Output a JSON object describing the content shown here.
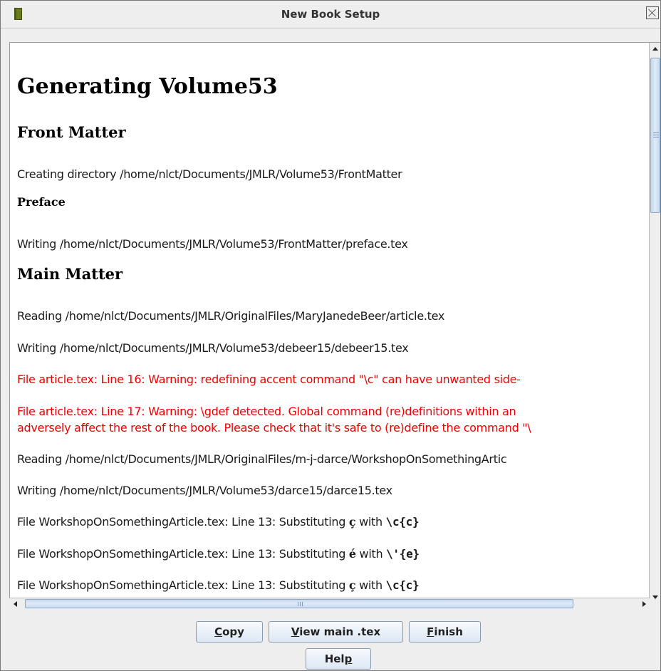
{
  "window": {
    "title": "New Book Setup"
  },
  "doc": {
    "heading": "Generating Volume53",
    "front_matter": {
      "heading": "Front Matter",
      "creating": "Creating directory /home/nlct/Documents/JMLR/Volume53/FrontMatter",
      "preface_heading": "Preface",
      "preface_writing": "Writing /home/nlct/Documents/JMLR/Volume53/FrontMatter/preface.tex"
    },
    "main_matter": {
      "heading": "Main Matter",
      "reading1": "Reading /home/nlct/Documents/JMLR/OriginalFiles/MaryJanedeBeer/article.tex",
      "writing1": "Writing /home/nlct/Documents/JMLR/Volume53/debeer15/debeer15.tex",
      "warning1": "File article.tex: Line 16: Warning: redefining accent command \"\\c\" can have unwanted side-",
      "warning2_line1": "File article.tex: Line 17: Warning: \\gdef detected. Global command (re)definitions within an",
      "warning2_line2": "adversely affect the rest of the book. Please check that it's safe to (re)define the command \"\\",
      "reading2": "Reading /home/nlct/Documents/JMLR/OriginalFiles/m-j-darce/WorkshopOnSomethingArtic",
      "writing2": "Writing /home/nlct/Documents/JMLR/Volume53/darce15/darce15.tex",
      "subs": [
        {
          "prefix": "File WorkshopOnSomethingArticle.tex: Line 13: Substituting ",
          "char": "ç",
          "with": " with ",
          "code": "\\c{c}"
        },
        {
          "prefix": "File WorkshopOnSomethingArticle.tex: Line 13: Substituting ",
          "char": "é",
          "with": " with ",
          "code": "\\'{e}"
        },
        {
          "prefix": "File WorkshopOnSomethingArticle.tex: Line 13: Substituting ",
          "char": "ç",
          "with": " with ",
          "code": "\\c{c}"
        }
      ]
    }
  },
  "buttons": {
    "copy_mn": "C",
    "copy_rest": "opy",
    "view_mn": "V",
    "view_rest": "iew main .tex",
    "finish_mn": "F",
    "finish_rest": "inish",
    "help_pre": "Hel",
    "help_mn": "p"
  },
  "colors": {
    "warning": "#f00000",
    "scroll_thumb": "#c6d9ef",
    "button_top": "#f7fafe"
  }
}
